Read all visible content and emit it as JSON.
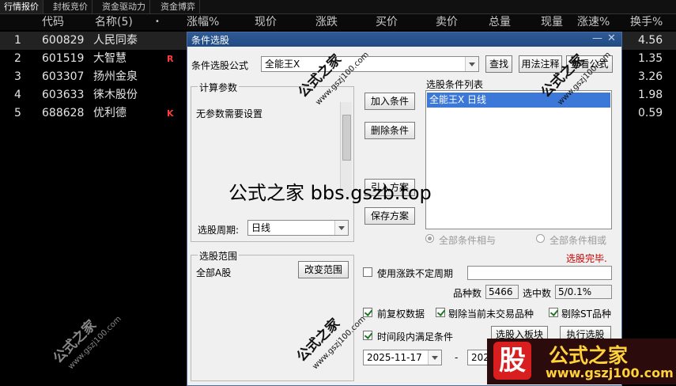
{
  "tabs": [
    "行情报价",
    "封板竞价",
    "资金驱动力",
    "资金博弈"
  ],
  "header": {
    "index": "",
    "code": "代码",
    "name": "名称(5)",
    "dot": "•",
    "change_pct": "涨幅%",
    "price": "现价",
    "change": "涨跌",
    "bid": "买价",
    "ask": "卖价",
    "volume": "总量",
    "current_vol": "现量",
    "speed": "涨速%",
    "turnover": "换手%"
  },
  "rows": [
    {
      "idx": "1",
      "code": "600829",
      "name": "人民同泰",
      "flag": "",
      "turnover": "4.56"
    },
    {
      "idx": "2",
      "code": "601519",
      "name": "大智慧",
      "flag": "R",
      "turnover": "1.35"
    },
    {
      "idx": "3",
      "code": "603307",
      "name": "扬州金泉",
      "flag": "",
      "turnover": "3.26"
    },
    {
      "idx": "4",
      "code": "603633",
      "name": "徕木股份",
      "flag": "",
      "turnover": "1.98"
    },
    {
      "idx": "5",
      "code": "688628",
      "name": "优利德",
      "flag": "K",
      "turnover": "0.59"
    }
  ],
  "dialog": {
    "title": "条件选股",
    "formula_label": "条件选股公式",
    "formula_value": "全能王X",
    "find_button": "查找",
    "usage_button": "用法注释",
    "view_button": "查看公式",
    "params_group": "计算参数",
    "params_text": "无参数需要设置",
    "period_label": "选股周期:",
    "period_value": "日线",
    "add_button": "加入条件",
    "delete_button": "删除条件",
    "import_button": "引入方案",
    "save_button": "保存方案",
    "conditions_label": "选股条件列表",
    "conditions": [
      "全能王X  日线"
    ],
    "radio_and": "全部条件相与",
    "radio_or": "全部条件相或",
    "status": "选股完毕.",
    "scope_group": "选股范围",
    "scope_value": "全部A股",
    "change_scope_button": "改变范围",
    "use_period_label": "使用涨跌不定周期",
    "count_label": "品种数",
    "count_value": "5466",
    "selected_label": "选中数",
    "selected_value": "5/0.1%",
    "adj_label": "前复权数据",
    "exclude_untraded_label": "剔除当前未交易品种",
    "exclude_st_label": "剔除ST品种",
    "time_range_label": "时间段内满足条件",
    "select_to_block_button": "选股入板块",
    "execute_button": "执行选股",
    "date_from": "2025-11-17",
    "date_sep": "-",
    "date_to": "202"
  },
  "watermarks": {
    "big": "公式之家",
    "site": "www.gszj100.com",
    "overlay": "公式之家 bbs.gszb.top",
    "logo_char": "股",
    "logo_text": "公式之家",
    "logo_site": "www.gszj100.com"
  },
  "colors": {
    "status": "#cc0000",
    "selection": "#3b78d8",
    "flag": "#ff3b3b"
  }
}
